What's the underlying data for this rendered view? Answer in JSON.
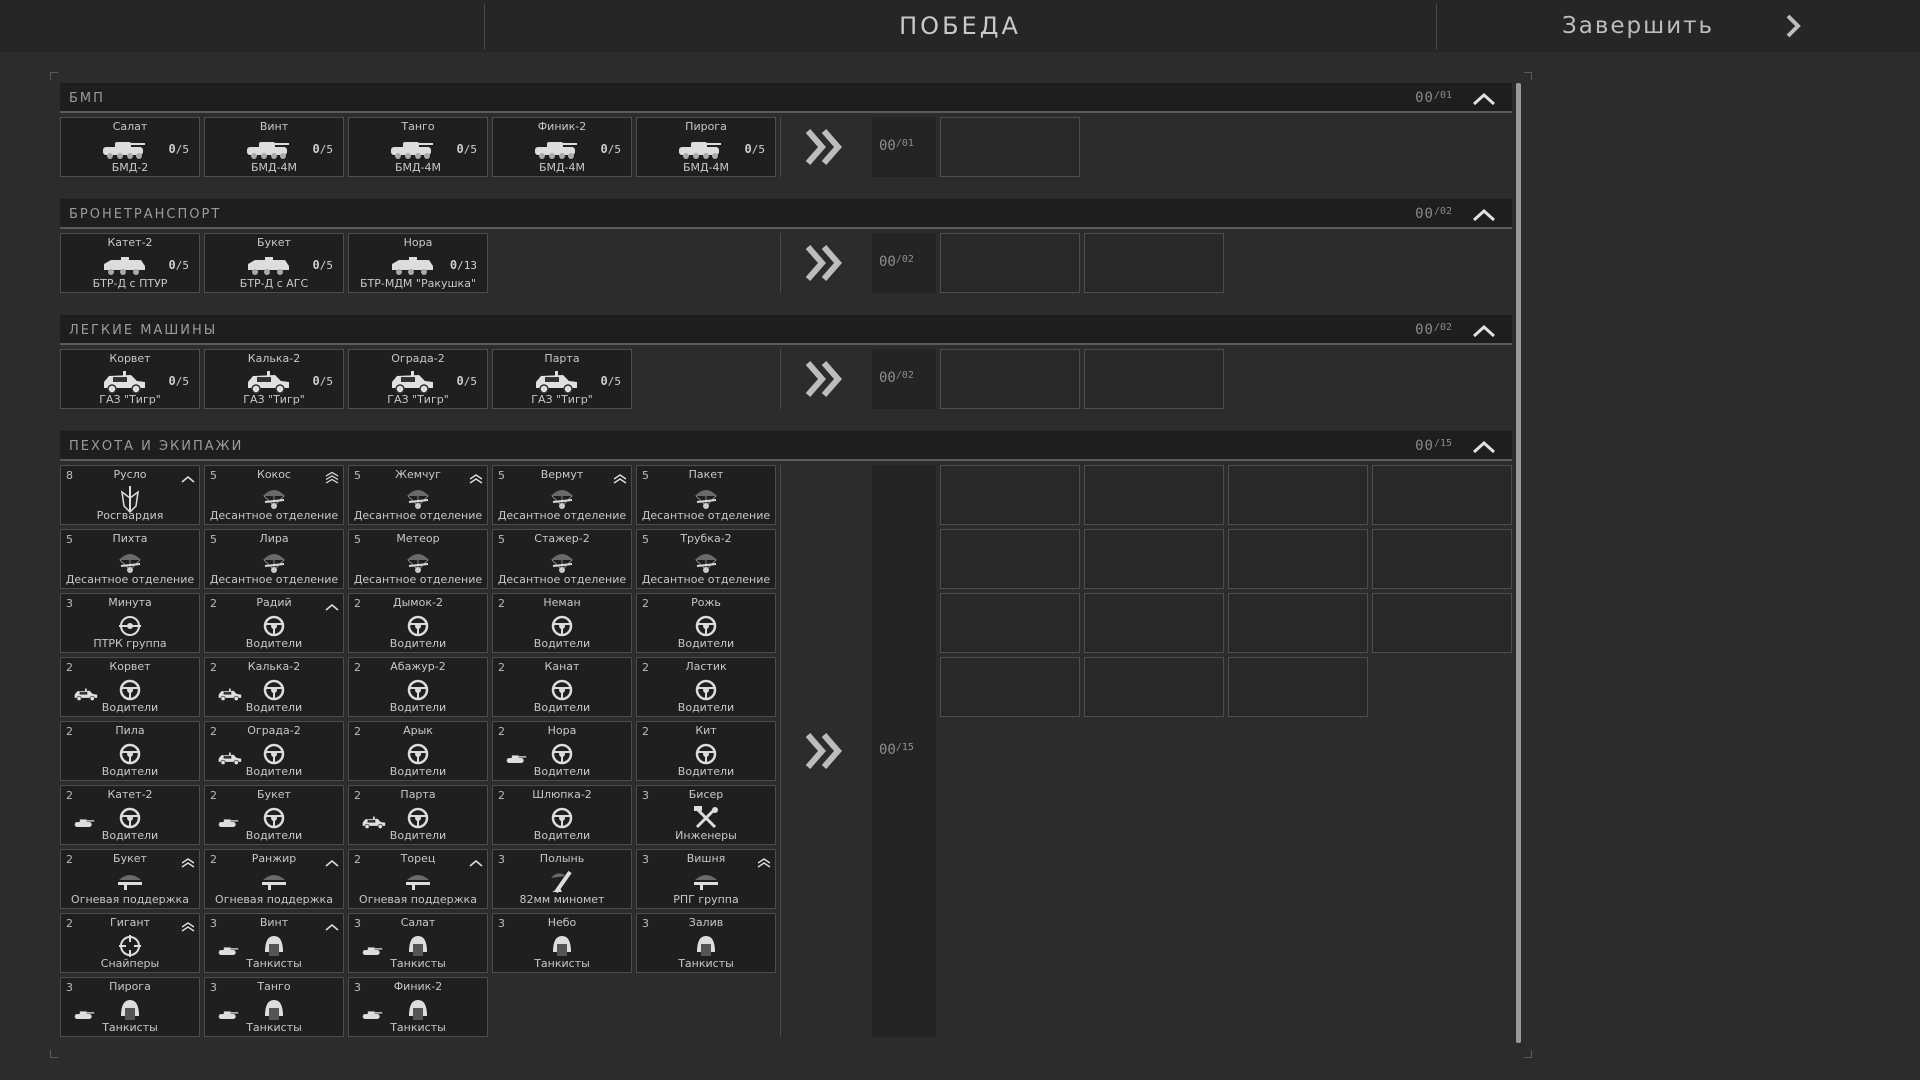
{
  "header": {
    "title": "ПОБЕДА",
    "finish_label": "Завершить"
  },
  "sections": [
    {
      "name": "БМП",
      "count": "00",
      "count_max": "/01"
    },
    {
      "name": "БРОНЕТРАНСПОРТ",
      "count": "00",
      "count_max": "/02"
    },
    {
      "name": "ЛЕГКИЕ МАШИНЫ",
      "count": "00",
      "count_max": "/02"
    },
    {
      "name": "ПЕХОТА И ЭКИПАЖИ",
      "count": "00",
      "count_max": "/15"
    }
  ],
  "bmp": [
    {
      "name": "Салат",
      "sub": "БМД-2",
      "q": "0",
      "max": "/5"
    },
    {
      "name": "Винт",
      "sub": "БМД-4М",
      "q": "0",
      "max": "/5"
    },
    {
      "name": "Танго",
      "sub": "БМД-4М",
      "q": "0",
      "max": "/5"
    },
    {
      "name": "Финик-2",
      "sub": "БМД-4М",
      "q": "0",
      "max": "/5"
    },
    {
      "name": "Пирога",
      "sub": "БМД-4М",
      "q": "0",
      "max": "/5"
    }
  ],
  "apc": [
    {
      "name": "Катет-2",
      "sub": "БТР-Д с ПТУР",
      "q": "0",
      "max": "/5"
    },
    {
      "name": "Букет",
      "sub": "БТР-Д с АГС",
      "q": "0",
      "max": "/5"
    },
    {
      "name": "Нора",
      "sub": "БТР-МДМ \"Ракушка\"",
      "q": "0",
      "max": "/13"
    }
  ],
  "light": [
    {
      "name": "Корвет",
      "sub": "ГАЗ \"Тигр\"",
      "q": "0",
      "max": "/5"
    },
    {
      "name": "Калька-2",
      "sub": "ГАЗ \"Тигр\"",
      "q": "0",
      "max": "/5"
    },
    {
      "name": "Ограда-2",
      "sub": "ГАЗ \"Тигр\"",
      "q": "0",
      "max": "/5"
    },
    {
      "name": "Парта",
      "sub": "ГАЗ \"Тигр\"",
      "q": "0",
      "max": "/5"
    }
  ],
  "slot_counts": [
    {
      "count": "00",
      "max": "/01"
    },
    {
      "count": "00",
      "max": "/02"
    },
    {
      "count": "00",
      "max": "/02"
    },
    {
      "count": "00",
      "max": "/15"
    }
  ],
  "infantry": [
    {
      "n": "8",
      "name": "Русло",
      "sub": "Росгвардия",
      "icon": "guard-icon",
      "rank": "rank1"
    },
    {
      "n": "5",
      "name": "Кокос",
      "sub": "Десантное отделение",
      "icon": "para-icon",
      "rank": "rank3"
    },
    {
      "n": "5",
      "name": "Жемчуг",
      "sub": "Десантное отделение",
      "icon": "para-icon",
      "rank": "rank2"
    },
    {
      "n": "5",
      "name": "Вермут",
      "sub": "Десантное отделение",
      "icon": "para-icon",
      "rank": "rank2"
    },
    {
      "n": "5",
      "name": "Пакет",
      "sub": "Десантное отделение",
      "icon": "para-icon",
      "rank": ""
    },
    {
      "n": "5",
      "name": "Пихта",
      "sub": "Десантное отделение",
      "icon": "para-icon",
      "rank": ""
    },
    {
      "n": "5",
      "name": "Лира",
      "sub": "Десантное отделение",
      "icon": "para-icon",
      "rank": ""
    },
    {
      "n": "5",
      "name": "Метеор",
      "sub": "Десантное отделение",
      "icon": "para-icon",
      "rank": ""
    },
    {
      "n": "5",
      "name": "Стажер-2",
      "sub": "Десантное отделение",
      "icon": "para-icon",
      "rank": ""
    },
    {
      "n": "5",
      "name": "Трубка-2",
      "sub": "Десантное отделение",
      "icon": "para-icon",
      "rank": ""
    },
    {
      "n": "3",
      "name": "Минута",
      "sub": "ПТРК группа",
      "icon": "atgm-icon",
      "rank": ""
    },
    {
      "n": "2",
      "name": "Радий",
      "sub": "Водители",
      "icon": "wheel-icon",
      "rank": "rank1"
    },
    {
      "n": "2",
      "name": "Дымок-2",
      "sub": "Водители",
      "icon": "wheel-icon",
      "rank": ""
    },
    {
      "n": "2",
      "name": "Неман",
      "sub": "Водители",
      "icon": "wheel-icon",
      "rank": ""
    },
    {
      "n": "2",
      "name": "Рожь",
      "sub": "Водители",
      "icon": "wheel-icon",
      "rank": ""
    },
    {
      "n": "2",
      "name": "Корвет",
      "sub": "Водители",
      "icon": "wheel-icon",
      "rank": "",
      "veh": "car"
    },
    {
      "n": "2",
      "name": "Калька-2",
      "sub": "Водители",
      "icon": "wheel-icon",
      "rank": "",
      "veh": "car"
    },
    {
      "n": "2",
      "name": "Абажур-2",
      "sub": "Водители",
      "icon": "wheel-icon",
      "rank": ""
    },
    {
      "n": "2",
      "name": "Канат",
      "sub": "Водители",
      "icon": "wheel-icon",
      "rank": ""
    },
    {
      "n": "2",
      "name": "Ластик",
      "sub": "Водители",
      "icon": "wheel-icon",
      "rank": ""
    },
    {
      "n": "2",
      "name": "Пила",
      "sub": "Водители",
      "icon": "wheel-icon",
      "rank": ""
    },
    {
      "n": "2",
      "name": "Ограда-2",
      "sub": "Водители",
      "icon": "wheel-icon",
      "rank": "",
      "veh": "car"
    },
    {
      "n": "2",
      "name": "Арык",
      "sub": "Водители",
      "icon": "wheel-icon",
      "rank": ""
    },
    {
      "n": "2",
      "name": "Нора",
      "sub": "Водители",
      "icon": "wheel-icon",
      "rank": "",
      "veh": "tank"
    },
    {
      "n": "2",
      "name": "Кит",
      "sub": "Водители",
      "icon": "wheel-icon",
      "rank": ""
    },
    {
      "n": "2",
      "name": "Катет-2",
      "sub": "Водители",
      "icon": "wheel-icon",
      "rank": "",
      "veh": "tank"
    },
    {
      "n": "2",
      "name": "Букет",
      "sub": "Водители",
      "icon": "wheel-icon",
      "rank": "",
      "veh": "tank"
    },
    {
      "n": "2",
      "name": "Парта",
      "sub": "Водители",
      "icon": "wheel-icon",
      "rank": "",
      "veh": "car"
    },
    {
      "n": "2",
      "name": "Шлюпка-2",
      "sub": "Водители",
      "icon": "wheel-icon",
      "rank": ""
    },
    {
      "n": "3",
      "name": "Бисер",
      "sub": "Инженеры",
      "icon": "tools-icon",
      "rank": ""
    },
    {
      "n": "2",
      "name": "Букет",
      "sub": "Огневая поддержка",
      "icon": "gun-icon",
      "rank": "rank2"
    },
    {
      "n": "2",
      "name": "Ранжир",
      "sub": "Огневая поддержка",
      "icon": "gun-icon",
      "rank": "rank1"
    },
    {
      "n": "2",
      "name": "Торец",
      "sub": "Огневая поддержка",
      "icon": "gun-icon",
      "rank": "rank1"
    },
    {
      "n": "3",
      "name": "Полынь",
      "sub": "82мм миномет",
      "icon": "mortar-icon",
      "rank": ""
    },
    {
      "n": "3",
      "name": "Вишня",
      "sub": "РПГ группа",
      "icon": "gun-icon",
      "rank": "rank2"
    },
    {
      "n": "2",
      "name": "Гигант",
      "sub": "Снайперы",
      "icon": "sniper-icon",
      "rank": "rank2"
    },
    {
      "n": "3",
      "name": "Винт",
      "sub": "Танкисты",
      "icon": "helmet-icon",
      "rank": "rank1",
      "veh": "tank"
    },
    {
      "n": "3",
      "name": "Салат",
      "sub": "Танкисты",
      "icon": "helmet-icon",
      "rank": "",
      "veh": "tank"
    },
    {
      "n": "3",
      "name": "Небо",
      "sub": "Танкисты",
      "icon": "helmet-icon",
      "rank": ""
    },
    {
      "n": "3",
      "name": "Залив",
      "sub": "Танкисты",
      "icon": "helmet-icon",
      "rank": ""
    },
    {
      "n": "3",
      "name": "Пирога",
      "sub": "Танкисты",
      "icon": "helmet-icon",
      "rank": "",
      "veh": "tank"
    },
    {
      "n": "3",
      "name": "Танго",
      "sub": "Танкисты",
      "icon": "helmet-icon",
      "rank": "",
      "veh": "tank"
    },
    {
      "n": "3",
      "name": "Финик-2",
      "sub": "Танкисты",
      "icon": "helmet-icon",
      "rank": "",
      "veh": "tank"
    }
  ]
}
